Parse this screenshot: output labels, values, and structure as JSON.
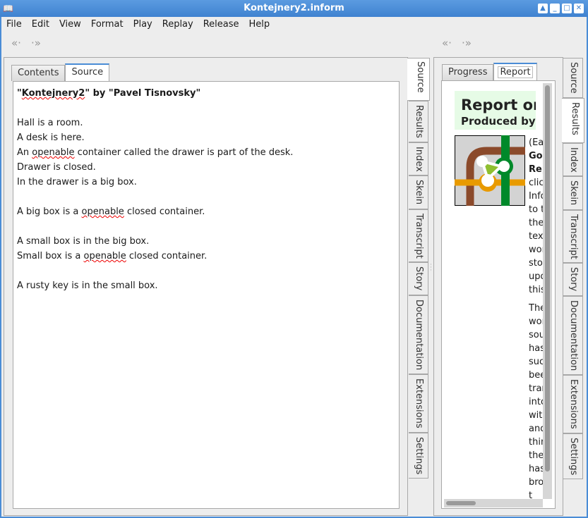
{
  "window": {
    "title": "Kontejnery2.inform",
    "controls": [
      "up",
      "minimize",
      "maximize",
      "close"
    ]
  },
  "menu": [
    "File",
    "Edit",
    "View",
    "Format",
    "Play",
    "Replay",
    "Release",
    "Help"
  ],
  "left": {
    "tabs": [
      "Contents",
      "Source"
    ],
    "selected_tab": "Source",
    "source": {
      "title_line": [
        "\"",
        "Kontejnery2",
        "\" by \"Pavel Tisnovsky\""
      ],
      "lines": [
        "",
        "Hall is a room.",
        "A desk is here.",
        [
          "An ",
          "openable",
          " container called the drawer is part of the desk."
        ],
        "Drawer is closed.",
        "In the drawer is a big box.",
        "",
        [
          "A big box is a ",
          "openable",
          " closed container."
        ],
        "",
        "A small box is in the big box.",
        [
          "Small box is a ",
          "openable",
          " closed container."
        ],
        "",
        "A rusty key is in the small box."
      ]
    },
    "side_tabs": [
      "Source",
      "Results",
      "Index",
      "Skein",
      "Transcript",
      "Story",
      "Documentation",
      "Extensions",
      "Settings"
    ],
    "side_selected": "Source"
  },
  "right": {
    "tabs": [
      "Progress",
      "Report"
    ],
    "selected_tab": "Report",
    "report": {
      "heading": "Report on",
      "subheading": "Produced by In",
      "col1": [
        "(Eac",
        "Go",
        "Rep",
        "click",
        "Info",
        "to t",
        "the",
        "text",
        "wor",
        "stor",
        "upd",
        "this"
      ],
      "col2": [
        "The",
        "wor",
        "sou",
        "has",
        "succ",
        "bee",
        "tran",
        "into",
        "with",
        "and",
        "thin",
        "the",
        "has",
        "brou",
        "t"
      ]
    },
    "side_tabs": [
      "Source",
      "Results",
      "Index",
      "Skein",
      "Transcript",
      "Story",
      "Documentation",
      "Extensions",
      "Settings"
    ],
    "side_selected": "Results"
  },
  "colors": {
    "titlebar": "#4a8cd6",
    "report_header_bg": "#e6fbe6",
    "logo_green": "#00892a",
    "logo_brown": "#8b4a2b",
    "logo_orange": "#e89a00"
  }
}
